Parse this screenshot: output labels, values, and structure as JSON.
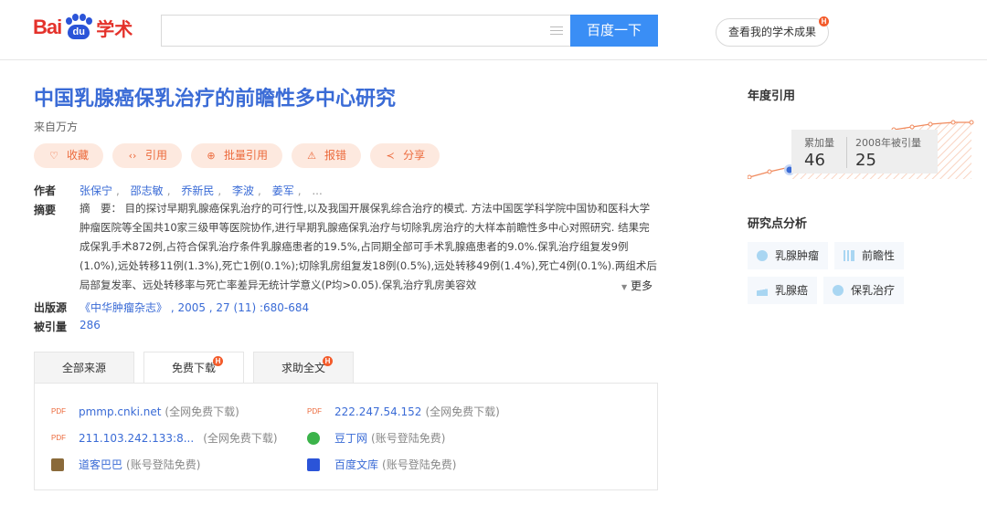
{
  "header": {
    "logo": {
      "bai": "Bai",
      "du": "du",
      "xueshu": "学术"
    },
    "search": {
      "value": "",
      "placeholder": ""
    },
    "search_button": "百度一下",
    "my_achievements": "查看我的学术成果",
    "badge": "H"
  },
  "paper": {
    "title": "中国乳腺癌保乳治疗的前瞻性多中心研究",
    "source_from": "来自万方",
    "actions": [
      "收藏",
      "引用",
      "批量引用",
      "报错",
      "分享"
    ],
    "authors_label": "作者",
    "authors": [
      "张保宁",
      "邵志敏",
      "乔新民",
      "李波",
      "姜军"
    ],
    "authors_more": "...",
    "abstract_label": "摘要",
    "abstract": "摘　要： 目的探讨早期乳腺癌保乳治疗的可行性,以及我国开展保乳综合治疗的模式. 方法中国医学科学院中国协和医科大学肿瘤医院等全国共10家三级甲等医院协作,进行早期乳腺癌保乳治疗与切除乳房治疗的大样本前瞻性多中心对照研究. 结果完成保乳手术872例,占符合保乳治疗条件乳腺癌患者的19.5%,占同期全部可手术乳腺癌患者的9.0%.保乳治疗组复发9例(1.0%),远处转移11例(1.3%),死亡1例(0.1%);切除乳房组复发18例(0.5%),远处转移49例(1.4%),死亡4例(0.1%).两组术后局部复发率、远处转移率与死亡率差异无统计学意义(P均>0.05).保乳治疗乳房美容效",
    "more": "更多",
    "publisher_label": "出版源",
    "publisher": "《中华肿瘤杂志》 , 2005 , 27 (11) :680-684",
    "cited_label": "被引量",
    "cited": "286"
  },
  "tabs": [
    {
      "label": "全部来源",
      "badge": false
    },
    {
      "label": "免费下载",
      "badge": true
    },
    {
      "label": "求助全文",
      "badge": true
    }
  ],
  "downloads": [
    {
      "icon": "pdf",
      "icon_text": "PDF",
      "link": "pmmp.cnki.net",
      "note": "(全网免费下载)"
    },
    {
      "icon": "pdf",
      "icon_text": "PDF",
      "link": "222.247.54.152",
      "note": "(全网免费下载)"
    },
    {
      "icon": "pdf",
      "icon_text": "PDF",
      "link": "211.103.242.133:8...",
      "note": "(全网免费下载)"
    },
    {
      "icon": "docin",
      "link": "豆丁网",
      "note": "(账号登陆免费)"
    },
    {
      "icon": "doc88",
      "link": "道客巴巴",
      "note": "(账号登陆免费)"
    },
    {
      "icon": "baidu-wenku",
      "link": "百度文库",
      "note": "(账号登陆免费)"
    }
  ],
  "sidebar": {
    "annual_citation_title": "年度引用",
    "tooltip": {
      "cumulative_label": "累加量",
      "cumulative_value": "46",
      "year_label": "2008年被引量",
      "year_value": "25"
    },
    "research_title": "研究点分析",
    "keywords": [
      {
        "label": "乳腺肿瘤",
        "icon": "pie-icon"
      },
      {
        "label": "前瞻性",
        "icon": "bar-icon"
      },
      {
        "label": "乳腺癌",
        "icon": "area-icon"
      },
      {
        "label": "保乳治疗",
        "icon": "pie-icon"
      }
    ]
  },
  "colors": {
    "accent": "#3a8ef5",
    "link": "#3a6bd6",
    "action_bg": "#fde9df",
    "action_fg": "#ec6a3c",
    "logo_red": "#e4322b",
    "logo_blue": "#2b54d8"
  }
}
